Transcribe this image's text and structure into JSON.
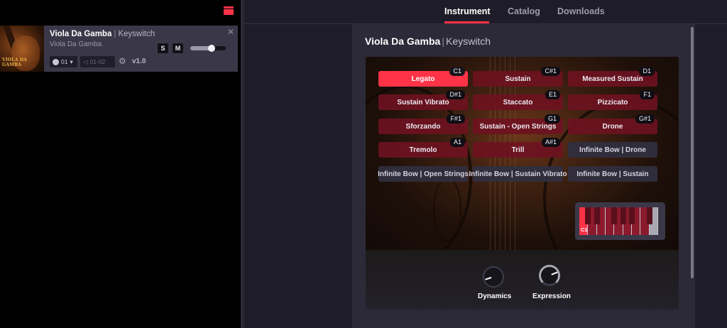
{
  "rack": {
    "slot": {
      "title": "Viola Da Gamba",
      "title_sep": "|",
      "title_sub": "Keyswitch",
      "name": "Viola Da Gamba",
      "thumb_text": "VIOLA DA GAMBA",
      "midi_channel": "01",
      "output": "01-02",
      "version": "v1.0",
      "solo_label": "S",
      "mute_label": "M",
      "volume_level": 0.62
    }
  },
  "nav": {
    "tabs": [
      "Instrument",
      "Catalog",
      "Downloads"
    ],
    "active_tab": "Instrument"
  },
  "instrument": {
    "title": "Viola Da Gamba",
    "title_sep": "|",
    "title_sub": "Keyswitch",
    "keyswitches": [
      {
        "label": "Legato",
        "note": "C1",
        "state": "active"
      },
      {
        "label": "Sustain",
        "note": "C#1",
        "state": "art"
      },
      {
        "label": "Measured Sustain",
        "note": "D1",
        "state": "art"
      },
      {
        "label": "Sustain Vibrato",
        "note": "D#1",
        "state": "art"
      },
      {
        "label": "Staccato",
        "note": "E1",
        "state": "art"
      },
      {
        "label": "Pizzicato",
        "note": "F1",
        "state": "art"
      },
      {
        "label": "Sforzando",
        "note": "F#1",
        "state": "art"
      },
      {
        "label": "Sustain - Open Strings",
        "note": "G1",
        "state": "art"
      },
      {
        "label": "Drone",
        "note": "G#1",
        "state": "art"
      },
      {
        "label": "Tremolo",
        "note": "A1",
        "state": "art"
      },
      {
        "label": "Trill",
        "note": "A#1",
        "state": "art"
      },
      {
        "label": "Infinite Bow | Drone",
        "note": "",
        "state": "alt"
      },
      {
        "label": "Infinite Bow | Open Strings",
        "note": "",
        "state": "alt"
      },
      {
        "label": "Infinite Bow | Sustain Vibrato",
        "note": "",
        "state": "alt"
      },
      {
        "label": "Infinite Bow | Sustain",
        "note": "",
        "state": "alt"
      }
    ],
    "keyboard_label": "C1",
    "knobs": [
      {
        "label": "Dynamics",
        "value": 0.1
      },
      {
        "label": "Expression",
        "value": 0.75
      }
    ]
  },
  "colors": {
    "accent": "#ff3348",
    "articulation": "#6e1220",
    "alt_articulation": "#302e3e"
  },
  "icons": {
    "rack_menu": "hamburger-red-icon",
    "close": "close-icon",
    "settings": "gear-icon",
    "midi": "midi-icon",
    "output": "speaker-icon"
  }
}
